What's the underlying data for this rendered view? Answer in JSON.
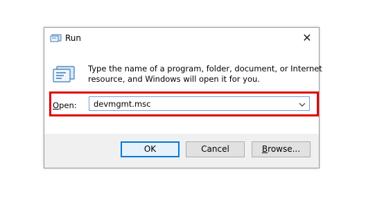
{
  "window": {
    "title": "Run",
    "close_glyph": "✕"
  },
  "description": {
    "line1": "Type the name of a program, folder, document, or Internet",
    "line2": "resource, and Windows will open it for you."
  },
  "open_field": {
    "label_mnemonic": "O",
    "label_rest": "pen:",
    "value": "devmgmt.msc"
  },
  "buttons": {
    "ok": "OK",
    "cancel": "Cancel",
    "browse_mnemonic": "B",
    "browse_rest": "rowse..."
  },
  "colors": {
    "highlight": "#e00000",
    "accent": "#0078d7"
  },
  "icons": {
    "title": "run-icon",
    "program": "run-program-icon",
    "close": "close-icon",
    "dropdown": "chevron-down-icon"
  }
}
